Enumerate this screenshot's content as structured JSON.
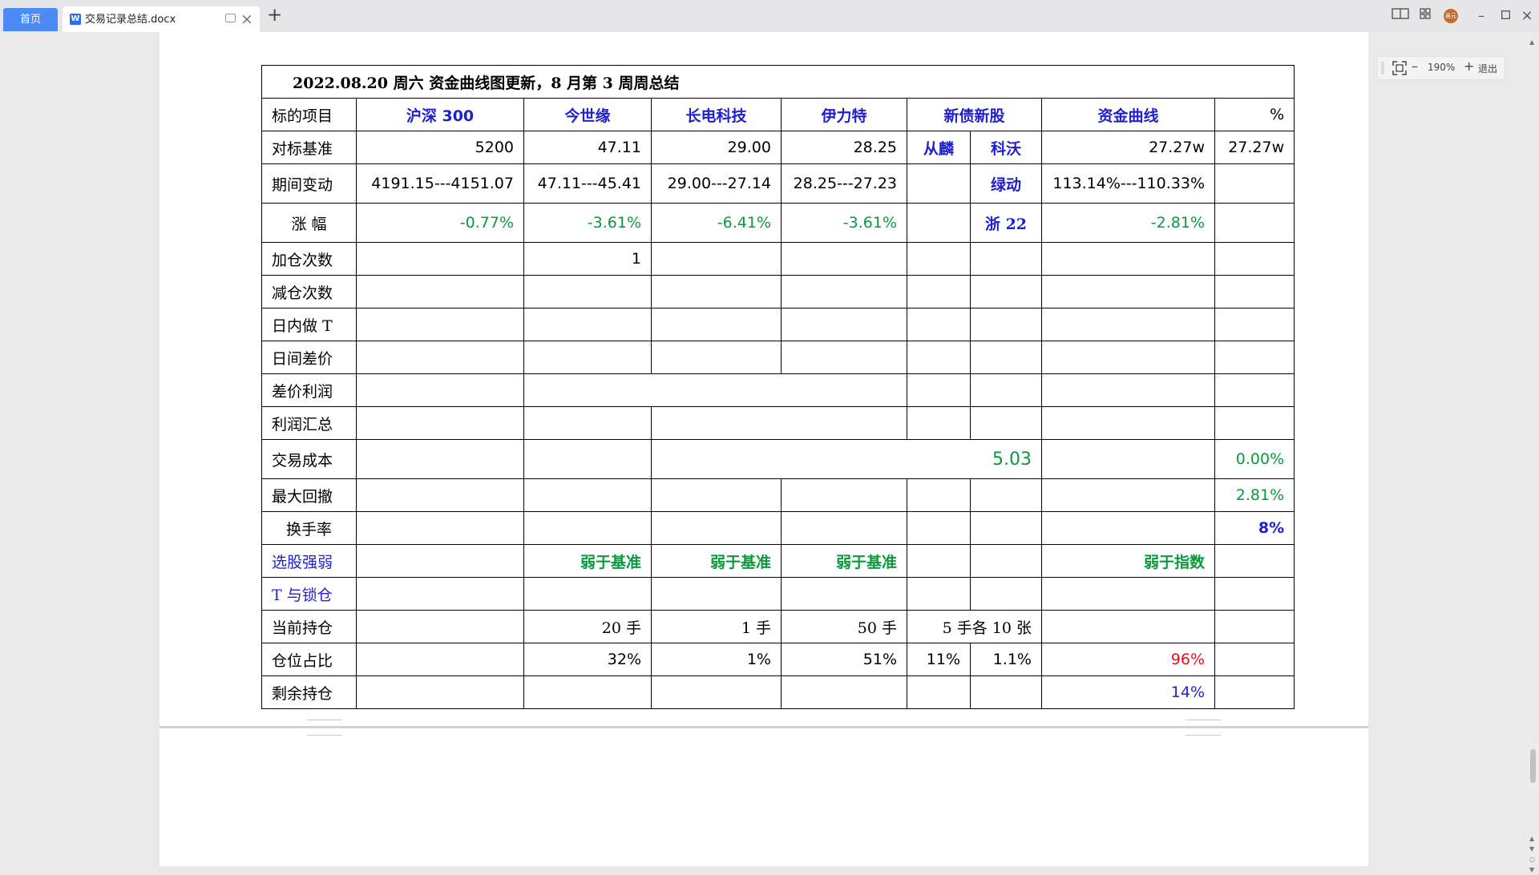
{
  "tabs": {
    "home": "首页",
    "document": "交易记录总结.docx"
  },
  "zoom": {
    "level": "190%",
    "exit": "退出"
  },
  "avatar": {
    "initials": "吴元"
  },
  "table": {
    "title": "2022.08.20  周六  资金曲线图更新，8 月第 3 周周总结",
    "header": {
      "label": "标的项目",
      "c1": "沪深 300",
      "c2": "今世缘",
      "c3": "长电科技",
      "c4": "伊力特",
      "c5": "新债新股",
      "c6": "资金曲线",
      "c7": "%"
    },
    "benchmark": {
      "label": "对标基准",
      "c1": "5200",
      "c2": "47.11",
      "c3": "29.00",
      "c4": "28.25",
      "c5a": "从麟",
      "c5b": "科沃",
      "c6": "27.27w",
      "c7": "27.27w"
    },
    "period_change": {
      "label": "期间变动",
      "c1": "4191.15---4151.07",
      "c2": "47.11---45.41",
      "c3": "29.00---27.14",
      "c4": "28.25---27.23",
      "c5b": "绿动",
      "c6": "113.14%---110.33%"
    },
    "change_pct": {
      "label": "涨  幅",
      "c1": "-0.77%",
      "c2": "-3.61%",
      "c3": "-6.41%",
      "c4": "-3.61%",
      "c5b": "浙 22",
      "c6": "-2.81%"
    },
    "add_count": {
      "label": "加仓次数",
      "c2": "1"
    },
    "reduce_count": {
      "label": "减仓次数"
    },
    "intraday_t": {
      "label": "日内做 T"
    },
    "interday_diff": {
      "label": "日间差价"
    },
    "diff_profit": {
      "label": "差价利润"
    },
    "profit_total": {
      "label": "利润汇总"
    },
    "trade_cost": {
      "label": "交易成本",
      "c345": "5.03",
      "c7": "0.00%"
    },
    "max_drawdown": {
      "label": "最大回撤",
      "c7": "2.81%"
    },
    "turnover": {
      "label": "换手率",
      "c7": "8%"
    },
    "stock_strength": {
      "label": "选股强弱",
      "c2": "弱于基准",
      "c3": "弱于基准",
      "c4": "弱于基准",
      "c6": "弱于指数"
    },
    "t_lock": {
      "label": "T 与锁仓"
    },
    "holding": {
      "label": "当前持仓",
      "c2": "20 手",
      "c3": "1 手",
      "c4": "50 手",
      "c5": "5 手各 10 张"
    },
    "position_ratio": {
      "label": "仓位占比",
      "c2": "32%",
      "c3": "1%",
      "c4": "51%",
      "c5a": "11%",
      "c5b": "1.1%",
      "c6": "96%"
    },
    "remaining": {
      "label": "剩余持仓",
      "c6": "14%"
    }
  }
}
